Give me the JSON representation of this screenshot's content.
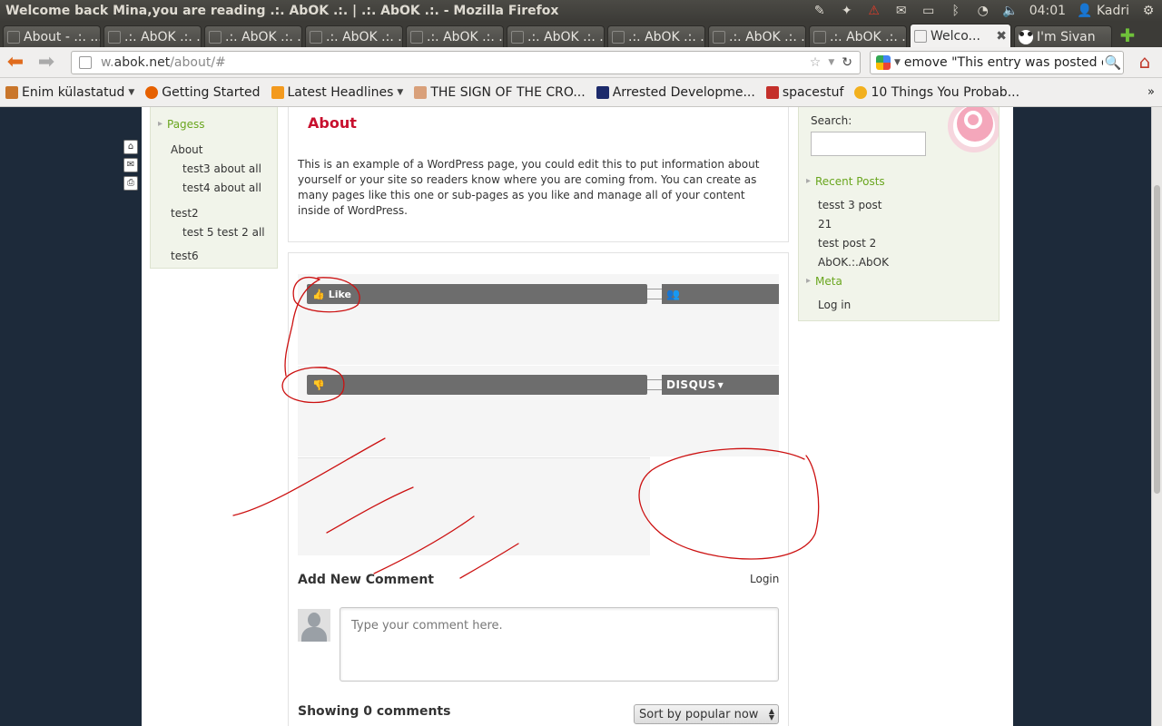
{
  "window": {
    "title": "Welcome back Mina,you are reading .:. AbOK .:. | .:. AbOK .:. - Mozilla Firefox"
  },
  "tray": {
    "time": "04:01",
    "user": "Kadri"
  },
  "tabs": [
    {
      "label": "About - .:. ..."
    },
    {
      "label": ".:. AbOK .:. ..."
    },
    {
      "label": ".:. AbOK .:. ..."
    },
    {
      "label": ".:. AbOK .:. ..."
    },
    {
      "label": ".:. AbOK .:. ..."
    },
    {
      "label": ".:. AbOK .:. ..."
    },
    {
      "label": ".:. AbOK .:. ..."
    },
    {
      "label": ".:. AbOK .:. ..."
    },
    {
      "label": ".:. AbOK .:. ..."
    },
    {
      "label": "Welco..."
    },
    {
      "label": "I'm Sivan"
    }
  ],
  "nav": {
    "url_prefix": "w.",
    "url_domain": "abok.net",
    "url_path": "/about/#",
    "search_query": "emove \"This entry was posted on\""
  },
  "bookmarks": [
    {
      "label": "Enim külastatud",
      "color": "#c9762b"
    },
    {
      "label": "Getting Started",
      "color": "#e66000"
    },
    {
      "label": "Latest Headlines",
      "color": "#f39a1e"
    },
    {
      "label": "THE SIGN OF THE CRO...",
      "color": "#d9a07a"
    },
    {
      "label": "Arrested Developme...",
      "color": "#1c2a6b"
    },
    {
      "label": "spacestuf",
      "color": "#c4302b"
    },
    {
      "label": "10 Things You Probab...",
      "color": "#f2b01e"
    }
  ],
  "leftnav": {
    "heading": "Pagess",
    "items": [
      {
        "label": "About",
        "children": [
          "test3 about all",
          "test4 about all"
        ]
      },
      {
        "label": "test2",
        "children": [
          "test 5 test 2 all"
        ]
      },
      {
        "label": "test6",
        "children": []
      }
    ]
  },
  "article": {
    "title": "About",
    "body": "This is an example of a WordPress page, you could edit this to put information about yourself or your site so readers know where you are coming from. You can create as many pages like this one or sub-pages as you like and manage all of your content inside of WordPress."
  },
  "disqus": {
    "like_label": "Like",
    "brand_label": "DISQUS",
    "add_comment": "Add New Comment",
    "login": "Login",
    "comment_placeholder": "Type your comment here.",
    "showing": "Showing 0 comments",
    "sort_label": "Sort by popular now"
  },
  "rightside": {
    "search_label": "Search:",
    "recent_heading": "Recent Posts",
    "recent_posts": [
      "tesst 3 post",
      "21",
      "test post 2",
      "AbOK.:.AbOK"
    ],
    "meta_heading": "Meta",
    "meta_items": [
      "Log in"
    ]
  },
  "colors": {
    "accent_green": "#6aa61f",
    "title_red": "#c8102e",
    "annotation_red": "#cc1111",
    "page_background": "#1d2a3a"
  }
}
